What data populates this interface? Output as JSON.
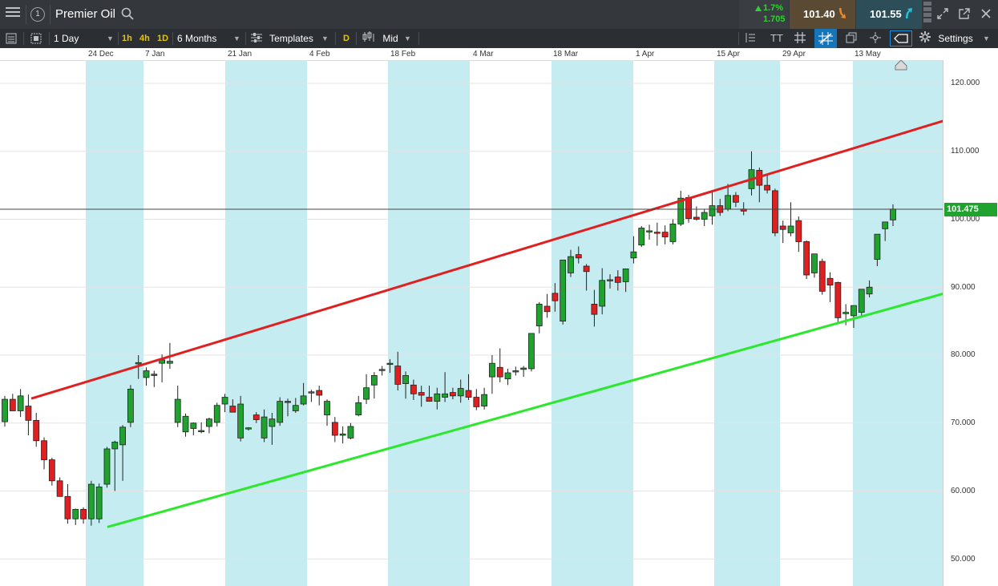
{
  "header": {
    "menu_icon": "hamburger-icon",
    "instrument_number": "1",
    "instrument_name": "Premier Oil",
    "search_icon": "search-icon",
    "change_pct": "1.7%",
    "change_abs": "1.705",
    "sell_price": "101.40",
    "buy_price": "101.55",
    "sell_arrow": "down-arrow-icon",
    "buy_arrow": "up-arrow-icon"
  },
  "toolbar": {
    "interval": "1 Day",
    "quick_intervals": [
      "1h",
      "4h",
      "1D"
    ],
    "range": "6 Months",
    "templates_label": "Templates",
    "d_label": "D",
    "price_type": "Mid",
    "settings_label": "Settings",
    "text_tool": "TT"
  },
  "colors": {
    "up_candle": "#1fa32e",
    "down_candle": "#e02020",
    "channel_upper": "#e02020",
    "channel_lower": "#2ce82c",
    "band": "#c4ecf1",
    "toolbar_bg": "#2b2e32",
    "header_bg": "#34383d"
  },
  "chart_data": {
    "type": "candlestick",
    "date_labels": [
      "24 Dec",
      "7 Jan",
      "21 Jan",
      "4 Feb",
      "18 Feb",
      "4 Mar",
      "18 Mar",
      "1 Apr",
      "15 Apr",
      "29 Apr",
      "13 May"
    ],
    "y_ticks": [
      "120.000",
      "110.000",
      "100.000",
      "90.000",
      "80.000",
      "70.000",
      "60.000",
      "50.000"
    ],
    "ylim": [
      47.3,
      123.2
    ],
    "current_price": "101.475",
    "grid": true,
    "candles": [
      [
        70.2,
        74.0,
        69.5,
        73.5
      ],
      [
        73.5,
        74.3,
        71.8,
        71.8
      ],
      [
        71.8,
        75.0,
        70.9,
        74.0
      ],
      [
        72.5,
        74.2,
        68.2,
        70.4
      ],
      [
        70.4,
        71.5,
        66.5,
        67.4
      ],
      [
        67.4,
        67.9,
        63.2,
        64.6
      ],
      [
        64.6,
        64.9,
        60.8,
        61.5
      ],
      [
        61.5,
        62.0,
        59.2,
        59.2
      ],
      [
        59.2,
        61.0,
        55.2,
        55.9
      ],
      [
        55.9,
        57.4,
        55.0,
        57.3
      ],
      [
        57.3,
        57.6,
        55.2,
        55.9
      ],
      [
        55.9,
        61.5,
        54.9,
        61.0
      ],
      [
        55.9,
        61.1,
        55.3,
        60.6
      ],
      [
        61.0,
        66.5,
        60.5,
        66.2
      ],
      [
        66.2,
        67.4,
        60.0,
        67.2
      ],
      [
        66.8,
        69.7,
        61.5,
        69.4
      ],
      [
        70.1,
        75.6,
        69.4,
        75.0
      ],
      [
        78.7,
        80.0,
        76.5,
        78.9
      ],
      [
        76.7,
        78.2,
        75.5,
        77.7
      ],
      [
        77.2,
        77.7,
        75.3,
        77.0
      ],
      [
        78.8,
        80.1,
        76.0,
        79.3
      ],
      [
        78.8,
        81.8,
        78.0,
        79.1
      ],
      [
        70.1,
        75.5,
        69.4,
        73.5
      ],
      [
        68.7,
        71.4,
        68.0,
        71.0
      ],
      [
        69.2,
        70.1,
        68.2,
        70.0
      ],
      [
        68.8,
        70.1,
        68.5,
        68.9
      ],
      [
        69.5,
        70.8,
        68.5,
        70.6
      ],
      [
        70.1,
        73.0,
        69.5,
        72.6
      ],
      [
        72.8,
        74.3,
        71.6,
        73.8
      ],
      [
        72.5,
        73.5,
        71.7,
        71.6
      ],
      [
        67.8,
        74.0,
        67.3,
        72.8
      ],
      [
        69.2,
        69.4,
        68.9,
        69.3
      ],
      [
        71.2,
        71.6,
        70.0,
        70.5
      ],
      [
        67.8,
        72.0,
        67.2,
        70.9
      ],
      [
        69.5,
        71.5,
        66.8,
        70.6
      ],
      [
        70.1,
        73.8,
        69.6,
        73.2
      ],
      [
        73.2,
        73.6,
        71.0,
        73.1
      ],
      [
        71.8,
        73.7,
        71.5,
        72.6
      ],
      [
        72.8,
        75.9,
        72.6,
        74.0
      ],
      [
        74.5,
        74.9,
        73.1,
        74.6
      ],
      [
        74.8,
        75.5,
        72.6,
        74.1
      ],
      [
        71.2,
        73.5,
        69.6,
        73.2
      ],
      [
        70.1,
        70.9,
        67.2,
        68.2
      ],
      [
        68.2,
        69.5,
        67.0,
        68.4
      ],
      [
        67.8,
        70.0,
        67.6,
        69.5
      ],
      [
        71.2,
        74.0,
        71.0,
        73.0
      ],
      [
        73.5,
        77.2,
        72.8,
        75.2
      ],
      [
        75.6,
        77.5,
        73.6,
        77.0
      ],
      [
        77.8,
        78.4,
        77.0,
        77.9
      ],
      [
        78.7,
        79.4,
        77.4,
        78.8
      ],
      [
        78.4,
        80.5,
        74.8,
        75.7
      ],
      [
        75.8,
        77.6,
        73.6,
        77.0
      ],
      [
        75.6,
        76.4,
        73.4,
        74.3
      ],
      [
        74.5,
        75.5,
        72.4,
        74.1
      ],
      [
        73.8,
        75.5,
        73.2,
        73.2
      ],
      [
        73.2,
        75.2,
        72.0,
        74.3
      ],
      [
        73.8,
        77.5,
        73.1,
        74.3
      ],
      [
        74.5,
        75.2,
        73.5,
        74.0
      ],
      [
        74.0,
        76.4,
        73.0,
        75.1
      ],
      [
        74.8,
        77.2,
        73.4,
        73.8
      ],
      [
        73.8,
        75.0,
        71.9,
        72.4
      ],
      [
        72.5,
        75.2,
        72.0,
        74.2
      ],
      [
        76.8,
        80.0,
        74.3,
        78.8
      ],
      [
        78.2,
        81.0,
        76.0,
        76.8
      ],
      [
        76.5,
        78.0,
        75.6,
        77.4
      ],
      [
        77.7,
        78.3,
        77.0,
        77.7
      ],
      [
        77.9,
        78.4,
        76.8,
        78.1
      ],
      [
        78.0,
        83.2,
        77.6,
        83.2
      ],
      [
        84.3,
        87.8,
        83.2,
        87.5
      ],
      [
        87.2,
        89.0,
        85.5,
        86.4
      ],
      [
        89.1,
        90.6,
        86.4,
        88.0
      ],
      [
        85.0,
        92.5,
        84.5,
        94.0
      ],
      [
        92.1,
        95.5,
        91.5,
        94.5
      ],
      [
        94.8,
        96.0,
        93.5,
        94.3
      ],
      [
        93.1,
        93.4,
        89.5,
        92.3
      ],
      [
        87.5,
        89.6,
        84.2,
        86.0
      ],
      [
        87.2,
        92.8,
        86.0,
        91.0
      ],
      [
        91.0,
        91.9,
        89.8,
        91.1
      ],
      [
        91.5,
        92.5,
        89.5,
        90.7
      ],
      [
        90.8,
        92.5,
        89.3,
        92.7
      ],
      [
        94.3,
        97.5,
        93.5,
        95.2
      ],
      [
        96.2,
        99.0,
        95.9,
        98.7
      ],
      [
        98.3,
        99.2,
        97.0,
        98.3
      ],
      [
        98.1,
        99.5,
        96.1,
        98.0
      ],
      [
        98.1,
        99.1,
        96.3,
        97.4
      ],
      [
        96.7,
        100.0,
        96.3,
        99.3
      ],
      [
        99.3,
        104.2,
        99.0,
        103.1
      ],
      [
        103.2,
        103.6,
        99.5,
        100.1
      ],
      [
        100.3,
        101.9,
        99.8,
        100.0
      ],
      [
        100.0,
        101.5,
        99.0,
        101.0
      ],
      [
        100.5,
        104.0,
        99.2,
        102.0
      ],
      [
        102.0,
        103.0,
        100.5,
        101.0
      ],
      [
        101.5,
        105.2,
        101.2,
        103.5
      ],
      [
        103.5,
        104.0,
        101.8,
        102.5
      ],
      [
        101.5,
        102.5,
        100.6,
        101.2
      ],
      [
        104.5,
        110.0,
        103.5,
        107.3
      ],
      [
        107.2,
        107.6,
        102.5,
        105.0
      ],
      [
        105.0,
        106.5,
        103.8,
        104.3
      ],
      [
        104.2,
        104.5,
        97.5,
        98.0
      ],
      [
        99.0,
        99.8,
        96.5,
        98.5
      ],
      [
        98.0,
        102.5,
        97.5,
        99.0
      ],
      [
        99.8,
        100.4,
        95.2,
        96.7
      ],
      [
        96.7,
        96.9,
        91.2,
        91.8
      ],
      [
        92.1,
        94.9,
        91.4,
        94.9
      ],
      [
        93.8,
        94.2,
        88.9,
        89.4
      ],
      [
        91.3,
        92.2,
        87.8,
        90.3
      ],
      [
        90.7,
        90.8,
        84.8,
        85.5
      ],
      [
        86.1,
        87.5,
        84.4,
        86.3
      ],
      [
        85.8,
        87.3,
        84.0,
        87.3
      ],
      [
        86.3,
        89.7,
        85.8,
        89.7
      ],
      [
        89.0,
        91.0,
        88.5,
        90.0
      ],
      [
        94.1,
        95.4,
        93.1,
        97.8
      ],
      [
        98.6,
        99.2,
        96.8,
        99.6
      ],
      [
        99.9,
        102.2,
        99.0,
        101.5
      ]
    ],
    "channel_lines": [
      {
        "name": "upper",
        "from": [
          "2018-12-14",
          73.6
        ],
        "to": [
          "2019-05-22",
          115.3
        ]
      },
      {
        "name": "lower",
        "from": [
          "2018-12-27",
          54.7
        ],
        "to": [
          "2019-05-22",
          89.8
        ]
      }
    ]
  }
}
